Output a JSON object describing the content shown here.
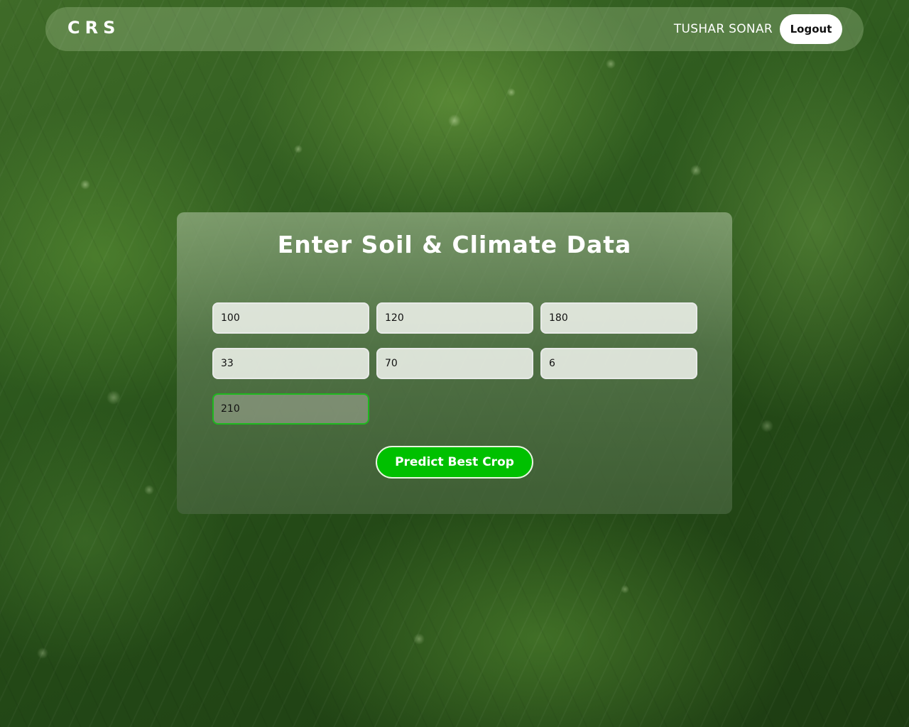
{
  "navbar": {
    "brand": "CRS",
    "username": "TUSHAR SONAR",
    "logout_label": "Logout"
  },
  "form": {
    "title": "Enter Soil & Climate Data",
    "fields": [
      {
        "value": "100"
      },
      {
        "value": "120"
      },
      {
        "value": "180"
      },
      {
        "value": "33"
      },
      {
        "value": "70"
      },
      {
        "value": "6"
      },
      {
        "value": "210"
      }
    ],
    "submit_label": "Predict Best Crop"
  },
  "colors": {
    "accent": "#00c000",
    "focus_border": "#1fb81f",
    "text": "#ffffff"
  }
}
